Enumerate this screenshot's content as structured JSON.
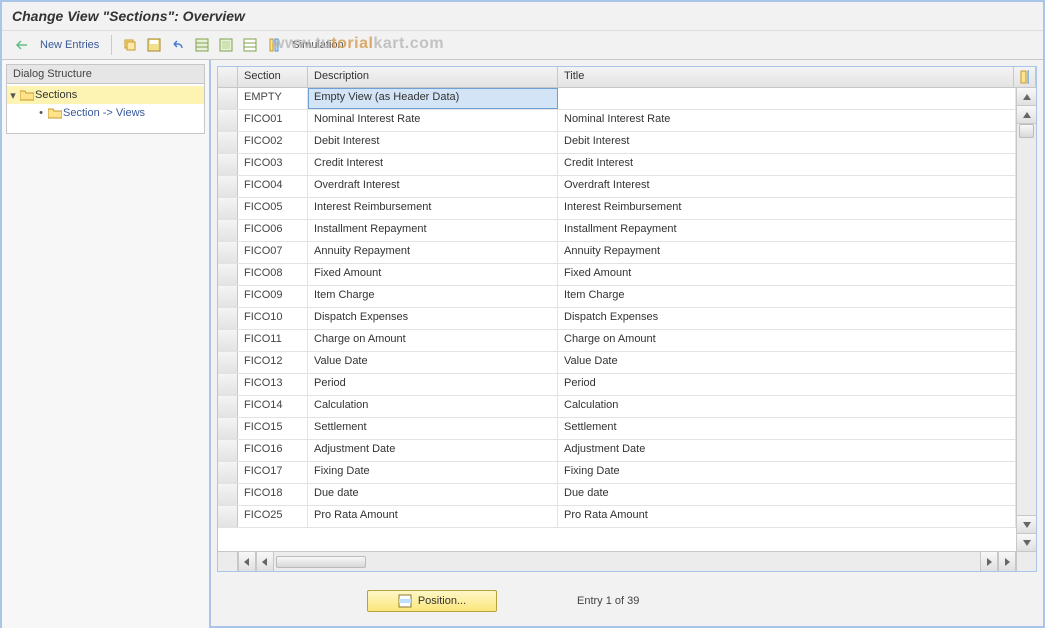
{
  "title": "Change View \"Sections\": Overview",
  "watermark": {
    "left": "www.tu",
    "mid": "torial",
    "right": "kart.com"
  },
  "toolbar": {
    "new_entries": "New Entries",
    "simulation": "Simulation"
  },
  "tree": {
    "header": "Dialog Structure",
    "root": "Sections",
    "child": "Section -> Views"
  },
  "table": {
    "headers": {
      "section": "Section",
      "description": "Description",
      "title": "Title"
    },
    "rows": [
      {
        "section": "EMPTY",
        "description": "Empty View (as Header Data)",
        "title": ""
      },
      {
        "section": "FICO01",
        "description": "Nominal Interest Rate",
        "title": "Nominal Interest Rate"
      },
      {
        "section": "FICO02",
        "description": "Debit Interest",
        "title": "Debit Interest"
      },
      {
        "section": "FICO03",
        "description": "Credit Interest",
        "title": "Credit Interest"
      },
      {
        "section": "FICO04",
        "description": "Overdraft Interest",
        "title": "Overdraft Interest"
      },
      {
        "section": "FICO05",
        "description": "Interest Reimbursement",
        "title": "Interest Reimbursement"
      },
      {
        "section": "FICO06",
        "description": "Installment Repayment",
        "title": "Installment Repayment"
      },
      {
        "section": "FICO07",
        "description": "Annuity Repayment",
        "title": "Annuity Repayment"
      },
      {
        "section": "FICO08",
        "description": "Fixed Amount",
        "title": "Fixed Amount"
      },
      {
        "section": "FICO09",
        "description": "Item Charge",
        "title": "Item Charge"
      },
      {
        "section": "FICO10",
        "description": "Dispatch Expenses",
        "title": "Dispatch Expenses"
      },
      {
        "section": "FICO11",
        "description": "Charge on Amount",
        "title": "Charge on Amount"
      },
      {
        "section": "FICO12",
        "description": "Value Date",
        "title": "Value Date"
      },
      {
        "section": "FICO13",
        "description": "Period",
        "title": "Period"
      },
      {
        "section": "FICO14",
        "description": "Calculation",
        "title": "Calculation"
      },
      {
        "section": "FICO15",
        "description": "Settlement",
        "title": "Settlement"
      },
      {
        "section": "FICO16",
        "description": "Adjustment Date",
        "title": "Adjustment Date"
      },
      {
        "section": "FICO17",
        "description": "Fixing Date",
        "title": "Fixing Date"
      },
      {
        "section": "FICO18",
        "description": "Due date",
        "title": "Due date"
      },
      {
        "section": "FICO25",
        "description": "Pro Rata Amount",
        "title": "Pro Rata Amount"
      }
    ]
  },
  "footer": {
    "position_button": "Position...",
    "entry_text": "Entry 1 of 39"
  }
}
